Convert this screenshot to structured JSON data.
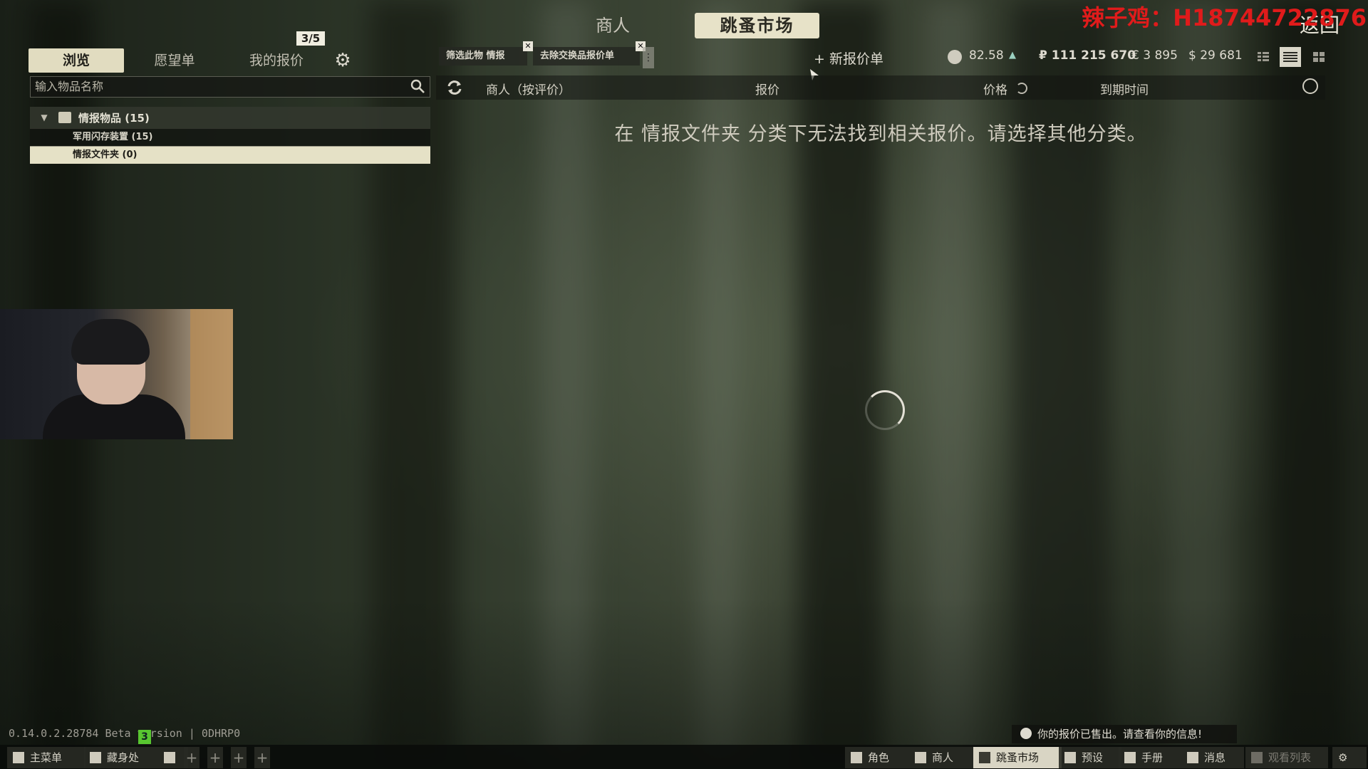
{
  "overlay_text": "辣子鸡：H18744722876",
  "header": {
    "merchants_tab": "商人",
    "flea_market_tab": "跳蚤市场",
    "back_button": "返回"
  },
  "left_panel": {
    "tabs": {
      "browse": "浏览",
      "wishlist": "愿望单",
      "my_offers": "我的报价"
    },
    "offers_count": "3/5",
    "search": {
      "placeholder": "输入物品名称",
      "value": ""
    },
    "tree": {
      "category": "情报物品 (15)",
      "items": [
        {
          "label": "军用闪存装置 (15)",
          "selected": false
        },
        {
          "label": "情报文件夹 (0)",
          "selected": true
        }
      ]
    }
  },
  "filters": {
    "chips": [
      "筛选此物 情报",
      "去除交换品报价单"
    ],
    "new_offer": "+ 新报价单"
  },
  "wallet": {
    "rating": "82.58",
    "roubles": "₽ 111 215 670",
    "euros": "€ 3 895",
    "dollars": "$ 29 681"
  },
  "table": {
    "columns": [
      "商人（按评价）",
      "报价",
      "价格",
      "到期时间"
    ],
    "empty_message": "在 情报文件夹 分类下无法找到相关报价。请选择其他分类。"
  },
  "footer": {
    "version": "0.14.0.2.28784 Beta version | 0DHRP0",
    "version_badge": "3",
    "notification": "你的报价已售出。请查看你的信息!"
  },
  "taskbar": {
    "main_menu": "主菜单",
    "hideout": "藏身处",
    "character": "角色",
    "traders": "商人",
    "flea_market": "跳蚤市场",
    "presets": "预设",
    "handbook": "手册",
    "messages": "消息",
    "watchlist": "观看列表"
  },
  "colors": {
    "accent": "#e1dcc0",
    "text": "#d8d6cc",
    "overlay_red": "#e01b1b",
    "badge_green": "#58c630"
  }
}
